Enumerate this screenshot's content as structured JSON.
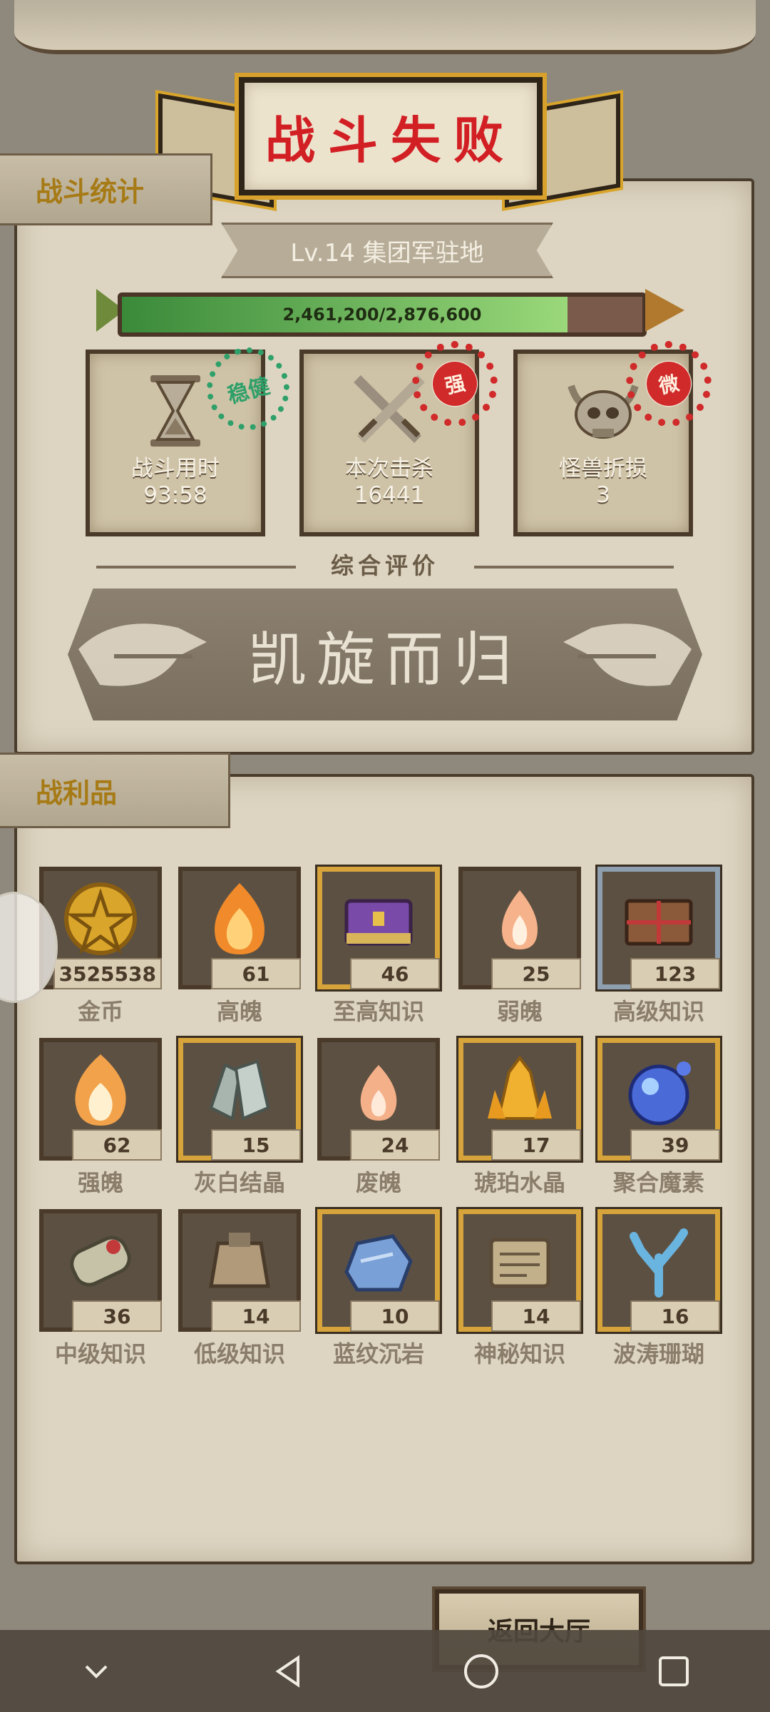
{
  "header": {
    "title": "战斗失败"
  },
  "stats_section": {
    "tab_label": "战斗统计"
  },
  "level": {
    "text": "Lv.14 集团军驻地"
  },
  "progress": {
    "text": "2,461,200/2,876,600",
    "current": 2461200,
    "max": 2876600
  },
  "stats": [
    {
      "label": "战斗用时",
      "value": "93:58",
      "icon": "hourglass-icon"
    },
    {
      "label": "本次击杀",
      "value": "16441",
      "icon": "crossed-swords-icon"
    },
    {
      "label": "怪兽折损",
      "value": "3",
      "icon": "horned-skull-icon"
    }
  ],
  "stamps": [
    {
      "text": "稳健",
      "color": "#2fa06a"
    },
    {
      "text": "强",
      "color": "#d02a2a"
    },
    {
      "text": "微",
      "color": "#d02a2a"
    }
  ],
  "rating": {
    "label": "综合评价",
    "result": "凯旋而归"
  },
  "loot_section": {
    "tab_label": "战利品"
  },
  "loot": [
    {
      "name": "金币",
      "count": "3525538",
      "icon": "gold-coin-icon",
      "frame": "plain"
    },
    {
      "name": "高魄",
      "count": "61",
      "icon": "fire-soul-icon",
      "frame": "plain"
    },
    {
      "name": "至高知识",
      "count": "46",
      "icon": "purple-book-icon",
      "frame": "gold"
    },
    {
      "name": "弱魄",
      "count": "25",
      "icon": "small-flame-icon",
      "frame": "plain"
    },
    {
      "name": "高级知识",
      "count": "123",
      "icon": "tied-book-icon",
      "frame": "silver"
    },
    {
      "name": "强魄",
      "count": "62",
      "icon": "flame-icon",
      "frame": "plain"
    },
    {
      "name": "灰白结晶",
      "count": "15",
      "icon": "grey-crystal-icon",
      "frame": "gold"
    },
    {
      "name": "废魄",
      "count": "24",
      "icon": "faint-flame-icon",
      "frame": "plain"
    },
    {
      "name": "琥珀水晶",
      "count": "17",
      "icon": "amber-crystal-icon",
      "frame": "gold"
    },
    {
      "name": "聚合魔素",
      "count": "39",
      "icon": "blue-orb-icon",
      "frame": "gold"
    },
    {
      "name": "中级知识",
      "count": "36",
      "icon": "scroll-icon",
      "frame": "plain"
    },
    {
      "name": "低级知识",
      "count": "14",
      "icon": "bag-scroll-icon",
      "frame": "plain"
    },
    {
      "name": "蓝纹沉岩",
      "count": "10",
      "icon": "blue-rock-icon",
      "frame": "gold"
    },
    {
      "name": "神秘知识",
      "count": "14",
      "icon": "stone-tablet-icon",
      "frame": "gold"
    },
    {
      "name": "波涛珊瑚",
      "count": "16",
      "icon": "coral-icon",
      "frame": "gold"
    }
  ],
  "return_button": {
    "label": "返回大厅"
  },
  "colors": {
    "title_red": "#d21f24",
    "tab_gold": "#a67a15",
    "parchment": "#ddd5c2"
  }
}
